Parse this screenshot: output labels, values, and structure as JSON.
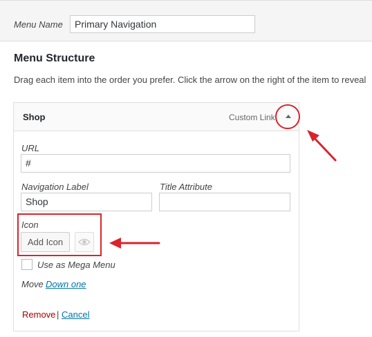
{
  "menu_name": {
    "label": "Menu Name",
    "value": "Primary Navigation"
  },
  "menu_structure": {
    "title": "Menu Structure",
    "description": "Drag each item into the order you prefer. Click the arrow on the right of the item to reveal"
  },
  "menu_item": {
    "title": "Shop",
    "type": "Custom Link",
    "toggle_icon": "arrow-up-icon",
    "url_label": "URL",
    "url_value": "#",
    "nav_label_label": "Navigation Label",
    "nav_label_value": "Shop",
    "title_attr_label": "Title Attribute",
    "title_attr_value": "",
    "icon_label": "Icon",
    "add_icon_label": "Add Icon",
    "eye_icon": "eye-icon",
    "mega_menu_label": "Use as Mega Menu",
    "mega_menu_checked": false,
    "move_label": "Move",
    "move_link": "Down one",
    "remove_label": "Remove",
    "separator": "|",
    "cancel_label": "Cancel"
  },
  "colors": {
    "annotation_red": "#d9232d",
    "link_blue": "#0073aa",
    "remove_red": "#aa0000"
  }
}
